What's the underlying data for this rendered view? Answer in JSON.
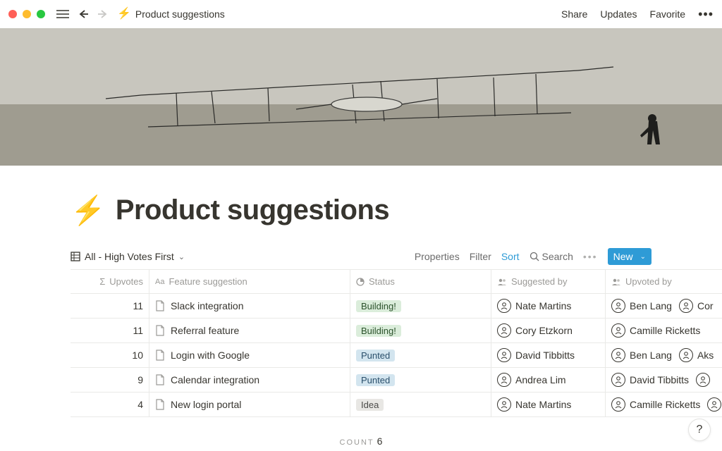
{
  "breadcrumb": {
    "icon": "⚡",
    "title": "Product suggestions"
  },
  "topbar": {
    "share": "Share",
    "updates": "Updates",
    "favorite": "Favorite"
  },
  "page": {
    "icon": "⚡",
    "title": "Product suggestions"
  },
  "view": {
    "name": "All - High Votes First"
  },
  "toolbar": {
    "properties": "Properties",
    "filter": "Filter",
    "sort": "Sort",
    "search": "Search",
    "new": "New"
  },
  "columns": {
    "upvotes": "Upvotes",
    "feature": "Feature suggestion",
    "status": "Status",
    "suggested_by": "Suggested by",
    "upvoted_by": "Upvoted by"
  },
  "rows": [
    {
      "upvotes": "11",
      "feature": "Slack integration",
      "status": "Building!",
      "status_class": "building",
      "suggested_by": "Nate Martins",
      "upvoted_by": [
        "Ben Lang",
        "Cor"
      ]
    },
    {
      "upvotes": "11",
      "feature": "Referral feature",
      "status": "Building!",
      "status_class": "building",
      "suggested_by": "Cory Etzkorn",
      "upvoted_by": [
        "Camille Ricketts"
      ]
    },
    {
      "upvotes": "10",
      "feature": "Login with Google",
      "status": "Punted",
      "status_class": "punted",
      "suggested_by": "David Tibbitts",
      "upvoted_by": [
        "Ben Lang",
        "Aks"
      ]
    },
    {
      "upvotes": "9",
      "feature": "Calendar integration",
      "status": "Punted",
      "status_class": "punted",
      "suggested_by": "Andrea Lim",
      "upvoted_by": [
        "David Tibbitts"
      ]
    },
    {
      "upvotes": "4",
      "feature": "New login portal",
      "status": "Idea",
      "status_class": "idea",
      "suggested_by": "Nate Martins",
      "upvoted_by": [
        "Camille Ricketts"
      ]
    }
  ],
  "footer": {
    "label": "COUNT",
    "value": "6"
  },
  "help": "?"
}
